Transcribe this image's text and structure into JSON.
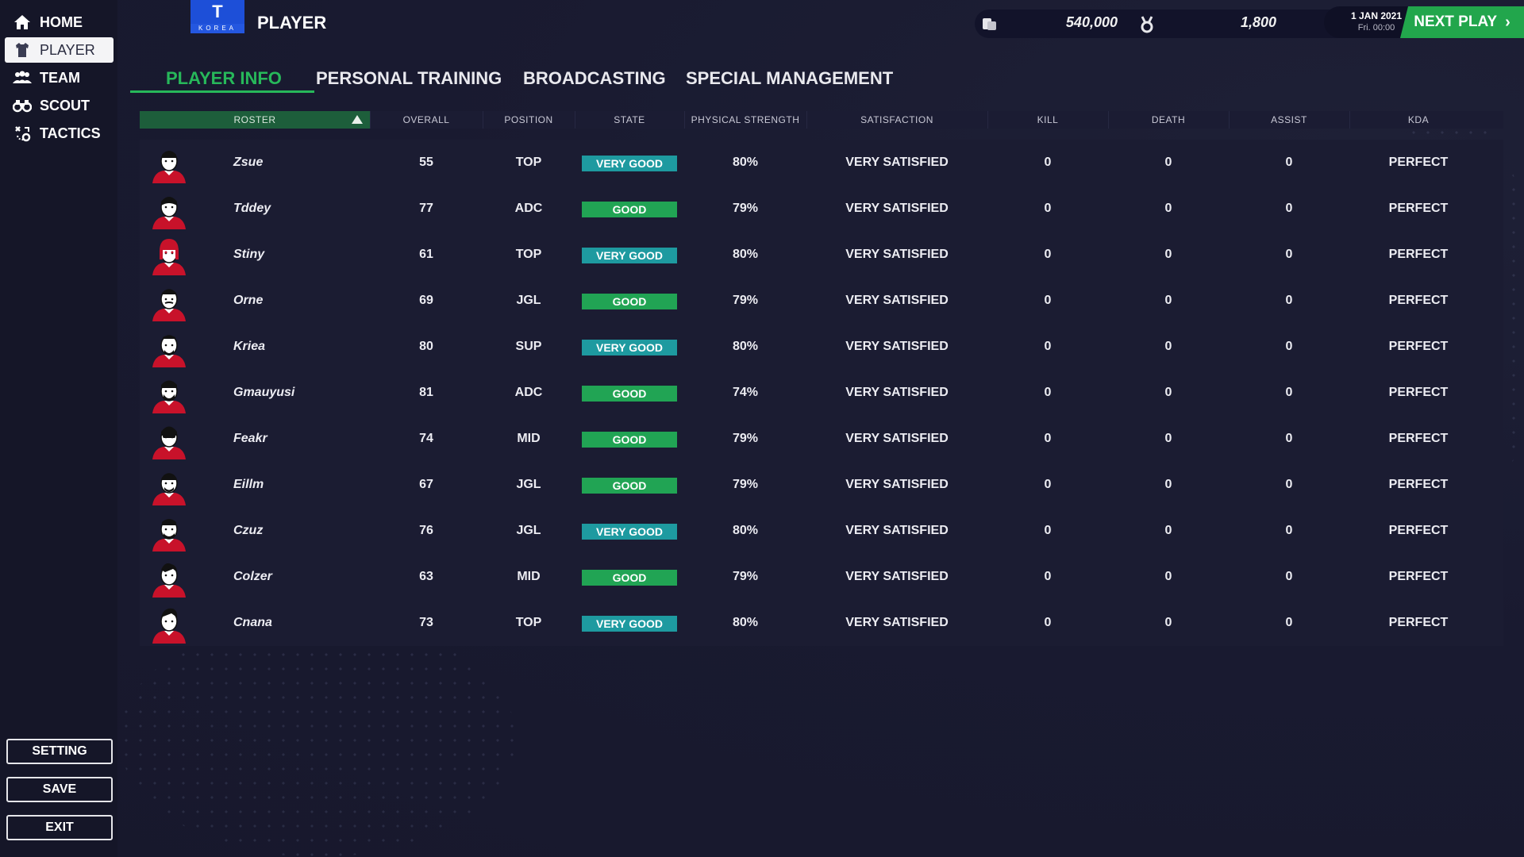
{
  "sidebar": {
    "items": [
      {
        "label": "HOME",
        "icon": "home-icon",
        "active": false
      },
      {
        "label": "PLAYER",
        "icon": "player-jersey-icon",
        "active": true
      },
      {
        "label": "TEAM",
        "icon": "team-icon",
        "active": false
      },
      {
        "label": "SCOUT",
        "icon": "binoculars-icon",
        "active": false
      },
      {
        "label": "TACTICS",
        "icon": "tactics-icon",
        "active": false
      }
    ],
    "buttons": {
      "setting": "SETTING",
      "save": "SAVE",
      "exit": "EXIT"
    }
  },
  "header": {
    "team_logo": {
      "letter": "T",
      "sub": "KOREA"
    },
    "title": "PLAYER",
    "money": "540,000",
    "fans": "1,800",
    "date": "1 JAN 2021",
    "time": "Fri. 00:00",
    "next_play": "NEXT PLAY",
    "accent": "#22a64c"
  },
  "tabs": [
    "PLAYER INFO",
    "PERSONAL TRAINING",
    "BROADCASTING",
    "SPECIAL MANAGEMENT"
  ],
  "table": {
    "columns": [
      "ROSTER",
      "OVERALL",
      "POSITION",
      "STATE",
      "PHYSICAL STRENGTH",
      "SATISFACTION",
      "KILL",
      "DEATH",
      "ASSIST",
      "KDA"
    ],
    "sort": {
      "column": "ROSTER",
      "direction": "ascending"
    },
    "state_colors": {
      "VERY GOOD": "#1e9aa0",
      "GOOD": "#21a454"
    },
    "rows": [
      {
        "name": "Zsue",
        "overall": "55",
        "position": "TOP",
        "state": "VERY GOOD",
        "strength": "80%",
        "satisfaction": "VERY SATISFIED",
        "kill": "0",
        "death": "0",
        "assist": "0",
        "kda": "PERFECT"
      },
      {
        "name": "Tddey",
        "overall": "77",
        "position": "ADC",
        "state": "GOOD",
        "strength": "79%",
        "satisfaction": "VERY SATISFIED",
        "kill": "0",
        "death": "0",
        "assist": "0",
        "kda": "PERFECT"
      },
      {
        "name": "Stiny",
        "overall": "61",
        "position": "TOP",
        "state": "VERY GOOD",
        "strength": "80%",
        "satisfaction": "VERY SATISFIED",
        "kill": "0",
        "death": "0",
        "assist": "0",
        "kda": "PERFECT"
      },
      {
        "name": "Orne",
        "overall": "69",
        "position": "JGL",
        "state": "GOOD",
        "strength": "79%",
        "satisfaction": "VERY SATISFIED",
        "kill": "0",
        "death": "0",
        "assist": "0",
        "kda": "PERFECT"
      },
      {
        "name": "Kriea",
        "overall": "80",
        "position": "SUP",
        "state": "VERY GOOD",
        "strength": "80%",
        "satisfaction": "VERY SATISFIED",
        "kill": "0",
        "death": "0",
        "assist": "0",
        "kda": "PERFECT"
      },
      {
        "name": "Gmauyusi",
        "overall": "81",
        "position": "ADC",
        "state": "GOOD",
        "strength": "74%",
        "satisfaction": "VERY SATISFIED",
        "kill": "0",
        "death": "0",
        "assist": "0",
        "kda": "PERFECT"
      },
      {
        "name": "Feakr",
        "overall": "74",
        "position": "MID",
        "state": "GOOD",
        "strength": "79%",
        "satisfaction": "VERY SATISFIED",
        "kill": "0",
        "death": "0",
        "assist": "0",
        "kda": "PERFECT"
      },
      {
        "name": "Eillm",
        "overall": "67",
        "position": "JGL",
        "state": "GOOD",
        "strength": "79%",
        "satisfaction": "VERY SATISFIED",
        "kill": "0",
        "death": "0",
        "assist": "0",
        "kda": "PERFECT"
      },
      {
        "name": "Czuz",
        "overall": "76",
        "position": "JGL",
        "state": "VERY GOOD",
        "strength": "80%",
        "satisfaction": "VERY SATISFIED",
        "kill": "0",
        "death": "0",
        "assist": "0",
        "kda": "PERFECT"
      },
      {
        "name": "Colzer",
        "overall": "63",
        "position": "MID",
        "state": "GOOD",
        "strength": "79%",
        "satisfaction": "VERY SATISFIED",
        "kill": "0",
        "death": "0",
        "assist": "0",
        "kda": "PERFECT"
      },
      {
        "name": "Cnana",
        "overall": "73",
        "position": "TOP",
        "state": "VERY GOOD",
        "strength": "80%",
        "satisfaction": "VERY SATISFIED",
        "kill": "0",
        "death": "0",
        "assist": "0",
        "kda": "PERFECT"
      }
    ]
  }
}
